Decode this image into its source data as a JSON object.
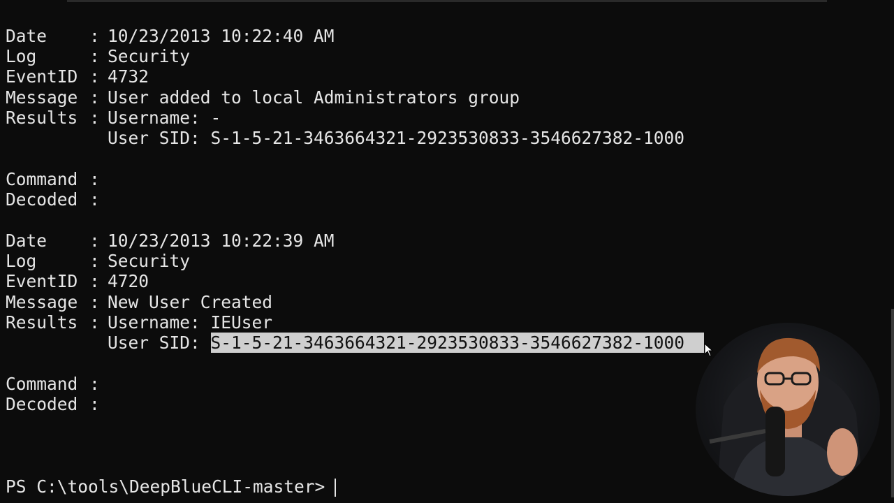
{
  "records": [
    {
      "date_key": "Date",
      "date": "10/23/2013 10:22:40 AM",
      "log_key": "Log",
      "log": "Security",
      "eventid_key": "EventID",
      "eventid": "4732",
      "message_key": "Message",
      "message": "User added to local Administrators group",
      "results_key": "Results",
      "results_username": "Username: -",
      "results_sid_label": "User SID: ",
      "results_sid": "S-1-5-21-3463664321-2923530833-3546627382-1000",
      "command_key": "Command",
      "decoded_key": "Decoded"
    },
    {
      "date_key": "Date",
      "date": "10/23/2013 10:22:39 AM",
      "log_key": "Log",
      "log": "Security",
      "eventid_key": "EventID",
      "eventid": "4720",
      "message_key": "Message",
      "message": "New User Created",
      "results_key": "Results",
      "results_username": "Username: IEUser",
      "results_sid_label": "User SID: ",
      "results_sid": "S-1-5-21-3463664321-2923530833-3546627382-1000",
      "command_key": "Command",
      "decoded_key": "Decoded"
    }
  ],
  "separator": ":",
  "prompt": "PS C:\\tools\\DeepBlueCLI-master>",
  "colors": {
    "background": "#0c0c0c",
    "foreground": "#e6e6e6",
    "selection_bg": "#cfcfcf",
    "selection_fg": "#111111"
  },
  "icons": {
    "pointer": "mouse-pointer-icon"
  }
}
